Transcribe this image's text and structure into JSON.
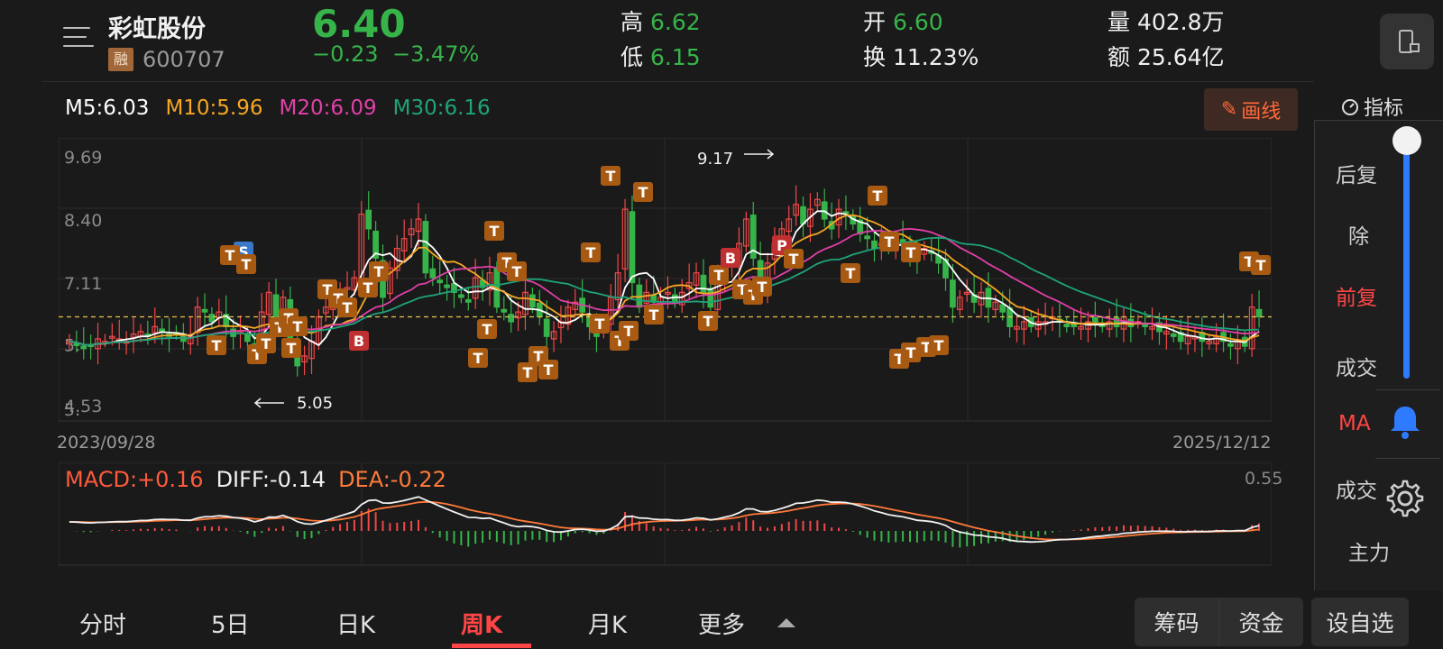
{
  "header": {
    "stock_name": "彩虹股份",
    "margin_badge": "融",
    "stock_code": "600707",
    "price": "6.40",
    "change": "−0.23",
    "change_pct": "−3.47%",
    "high_label": "高",
    "high_value": "6.62",
    "low_label": "低",
    "low_value": "6.15",
    "open_label": "开",
    "open_value": "6.60",
    "turnover_label": "换",
    "turnover_value": "11.23%",
    "volume_label": "量",
    "volume_value": "402.8万",
    "amount_label": "额",
    "amount_value": "25.64亿"
  },
  "ma_legend": {
    "m5": "M5:6.03",
    "m10": "M10:5.96",
    "m20": "M20:6.09",
    "m30": "M30:6.16"
  },
  "toolbar": {
    "draw_label": "画线",
    "indicator_label": "指标"
  },
  "side_panel": {
    "items": [
      "后复权",
      "除权",
      "前复权",
      "成交量",
      "MACD",
      "成交额",
      "主力"
    ],
    "items_visible": [
      "后复",
      "除",
      "前复",
      "成交",
      "MA",
      "成交",
      "主力"
    ],
    "active_index": 2
  },
  "chart": {
    "y_ticks": [
      "9.69",
      "8.40",
      "7.11",
      "5.",
      "4.53"
    ],
    "start_date": "2023/09/28",
    "end_date": "2025/12/12",
    "max_label": "9.17",
    "min_label": "5.05",
    "current_price": 6.4
  },
  "macd": {
    "macd_label": "MACD:+0.16",
    "diff_label": "DIFF:-0.14",
    "dea_label": "DEA:-0.22",
    "max_label": "0.55"
  },
  "tabs": [
    "分时",
    "5日",
    "日K",
    "周K",
    "月K",
    "更多"
  ],
  "active_tab": 3,
  "bottom_buttons": {
    "chips": "筹码",
    "funds": "资金",
    "add_watch": "设自选"
  },
  "colors": {
    "up": "#f04848",
    "down": "#36b44a",
    "m5": "#ffffff",
    "m10": "#f5a623",
    "m20": "#e040a8",
    "m30": "#1fa37a",
    "accent": "#ff4545",
    "marker": "#a85a12",
    "marker_b": "#c03030",
    "marker_s": "#3a78c9"
  },
  "chart_data": {
    "type": "candlestick",
    "period": "weekly",
    "x": [
      "2023/09/28",
      "2025/12/12"
    ],
    "ylim": [
      4.53,
      9.69
    ],
    "y_ticks": [
      9.69,
      8.4,
      7.11,
      4.53
    ],
    "high_point": 9.17,
    "low_point": 5.05,
    "last_close": 6.4,
    "closes": [
      5.9,
      5.85,
      5.75,
      5.8,
      5.95,
      5.9,
      6.0,
      5.95,
      5.9,
      6.05,
      6.1,
      6.0,
      6.2,
      6.1,
      6.0,
      6.05,
      5.9,
      6.0,
      6.6,
      6.5,
      6.3,
      6.5,
      6.2,
      6.0,
      6.1,
      5.9,
      5.6,
      6.5,
      6.9,
      6.3,
      6.8,
      5.8,
      5.4,
      5.6,
      5.9,
      6.4,
      6.6,
      6.7,
      6.9,
      7.0,
      7.2,
      8.5,
      8.2,
      7.6,
      6.8,
      7.4,
      7.8,
      8.0,
      8.2,
      8.4,
      7.3,
      7.2,
      7.1,
      7.0,
      6.9,
      6.8,
      6.7,
      7.2,
      7.0,
      7.3,
      6.6,
      6.5,
      6.3,
      6.5,
      6.9,
      6.6,
      6.4,
      6.0,
      6.1,
      6.3,
      6.6,
      6.7,
      6.5,
      6.2,
      6.0,
      6.3,
      6.8,
      7.3,
      8.6,
      7.1,
      6.6,
      6.9,
      6.7,
      6.8,
      6.9,
      6.7,
      6.9,
      7.1,
      7.3,
      6.9,
      6.6,
      7.2,
      7.4,
      7.5,
      7.9,
      8.4,
      7.6,
      7.0,
      7.5,
      7.9,
      8.2,
      8.4,
      8.7,
      8.3,
      8.6,
      8.8,
      8.4,
      8.2,
      8.6,
      8.5,
      8.3,
      8.1,
      8.0,
      7.8,
      7.9,
      7.8,
      7.9,
      7.9,
      7.7,
      7.6,
      7.8,
      7.7,
      7.5,
      7.2,
      6.6,
      6.8,
      6.9,
      6.7,
      6.9,
      6.6,
      6.7,
      6.5,
      6.2,
      6.2,
      6.3,
      6.2,
      6.3,
      6.3,
      6.4,
      6.3,
      6.2,
      6.2,
      6.2,
      6.3,
      6.3,
      6.2,
      6.3,
      6.2,
      6.4,
      6.2,
      6.3,
      6.2,
      6.2,
      6.1,
      6.1,
      6.0,
      5.9,
      6.0,
      6.0,
      5.9,
      5.9,
      6.0,
      5.9,
      5.8,
      5.9,
      5.8,
      6.6,
      6.4
    ],
    "series": [
      {
        "name": "M5",
        "value": 6.03
      },
      {
        "name": "M10",
        "value": 5.96
      },
      {
        "name": "M20",
        "value": 6.09
      },
      {
        "name": "M30",
        "value": 6.16
      }
    ]
  }
}
